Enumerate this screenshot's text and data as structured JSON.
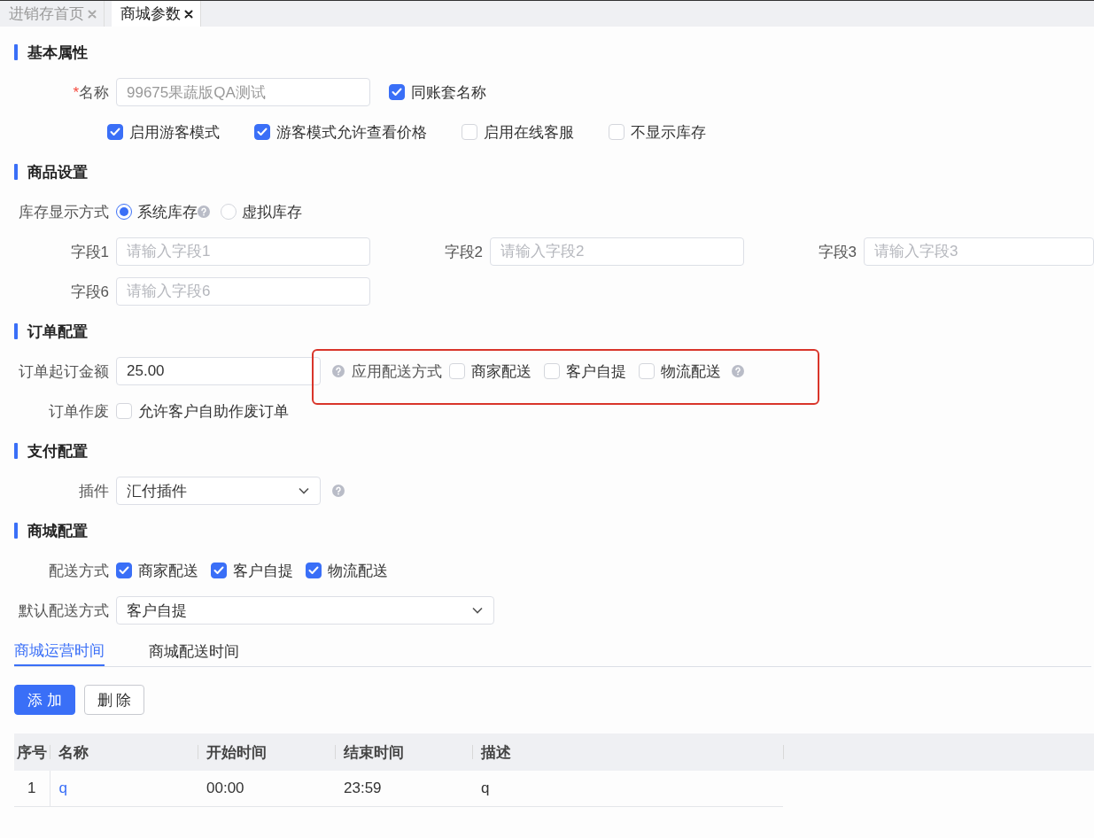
{
  "tabs": [
    {
      "label": "进销存首页",
      "selected": false
    },
    {
      "label": "商城参数",
      "selected": true
    }
  ],
  "sections": [
    {
      "title": "基本属性",
      "rows": [
        {
          "kind": "name",
          "label": "名称",
          "required_mark": "*",
          "value": "99675果蔬版QA测试",
          "disabled": true,
          "check": {
            "label": "同账套名称",
            "checked": true
          }
        },
        {
          "kind": "checks",
          "checks": [
            {
              "label": "启用游客模式",
              "checked": true
            },
            {
              "label": "游客模式允许查看价格",
              "checked": true
            },
            {
              "label": "启用在线客服",
              "checked": false
            },
            {
              "label": "不显示库存",
              "checked": false
            }
          ]
        }
      ]
    },
    {
      "title": "商品设置",
      "rows": [
        {
          "kind": "radio",
          "label": "库存显示方式",
          "options": [
            {
              "label": "系统库存",
              "selected": true,
              "help": true
            },
            {
              "label": "虚拟库存",
              "selected": false,
              "help": false
            }
          ]
        },
        {
          "kind": "fields",
          "fields": [
            {
              "label": "字段1",
              "placeholder": "请输入字段1"
            },
            {
              "label": "字段2",
              "placeholder": "请输入字段2"
            },
            {
              "label": "字段3",
              "placeholder": "请输入字段3"
            }
          ]
        },
        {
          "kind": "fields",
          "fields": [
            {
              "label": "字段6",
              "placeholder": "请输入字段6"
            }
          ]
        }
      ]
    },
    {
      "title": "订单配置",
      "rows": [
        {
          "kind": "amount",
          "label": "订单起订金额",
          "value": "25.00",
          "group": {
            "highlighted": true,
            "label": "应用配送方式",
            "checks": [
              {
                "label": "商家配送",
                "checked": false
              },
              {
                "label": "客户自提",
                "checked": false
              },
              {
                "label": "物流配送",
                "checked": false
              }
            ]
          }
        },
        {
          "kind": "checks",
          "label": "订单作废",
          "checks": [
            {
              "label": "允许客户自助作废订单",
              "checked": false
            }
          ]
        }
      ]
    },
    {
      "title": "支付配置",
      "rows": [
        {
          "kind": "select",
          "label": "插件",
          "value": "汇付插件",
          "help": true
        }
      ]
    },
    {
      "title": "商城配置",
      "rows": [
        {
          "kind": "checks",
          "label": "配送方式",
          "checks": [
            {
              "label": "商家配送",
              "checked": true
            },
            {
              "label": "客户自提",
              "checked": true
            },
            {
              "label": "物流配送",
              "checked": true
            }
          ]
        },
        {
          "kind": "select",
          "label": "默认配送方式",
          "value": "客户自提",
          "help": false
        }
      ]
    }
  ],
  "subtabs": [
    {
      "label": "商城运营时间",
      "selected": true
    },
    {
      "label": "商城配送时间",
      "selected": false
    }
  ],
  "buttons": [
    {
      "label": "添 加",
      "kind": "primary"
    },
    {
      "label": "删 除",
      "kind": "default"
    }
  ],
  "table": {
    "columns": [
      "序号",
      "名称",
      "开始时间",
      "结束时间",
      "描述"
    ],
    "rows": [
      [
        "1",
        "q",
        "00:00",
        "23:59",
        "q"
      ]
    ]
  }
}
